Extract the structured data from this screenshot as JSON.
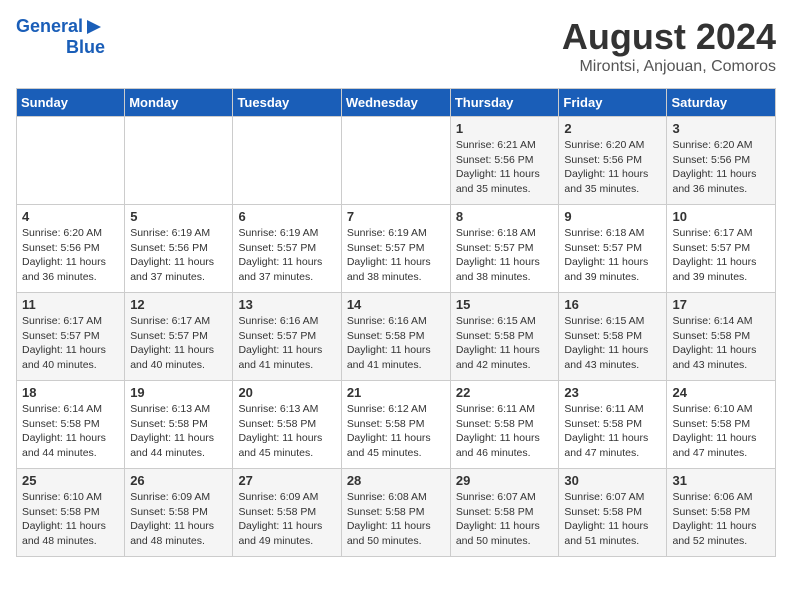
{
  "header": {
    "logo_line1": "General",
    "logo_line2": "Blue",
    "title": "August 2024",
    "subtitle": "Mirontsi, Anjouan, Comoros"
  },
  "days_of_week": [
    "Sunday",
    "Monday",
    "Tuesday",
    "Wednesday",
    "Thursday",
    "Friday",
    "Saturday"
  ],
  "weeks": [
    [
      {
        "day": "",
        "info": ""
      },
      {
        "day": "",
        "info": ""
      },
      {
        "day": "",
        "info": ""
      },
      {
        "day": "",
        "info": ""
      },
      {
        "day": "1",
        "info": "Sunrise: 6:21 AM\nSunset: 5:56 PM\nDaylight: 11 hours\nand 35 minutes."
      },
      {
        "day": "2",
        "info": "Sunrise: 6:20 AM\nSunset: 5:56 PM\nDaylight: 11 hours\nand 35 minutes."
      },
      {
        "day": "3",
        "info": "Sunrise: 6:20 AM\nSunset: 5:56 PM\nDaylight: 11 hours\nand 36 minutes."
      }
    ],
    [
      {
        "day": "4",
        "info": "Sunrise: 6:20 AM\nSunset: 5:56 PM\nDaylight: 11 hours\nand 36 minutes."
      },
      {
        "day": "5",
        "info": "Sunrise: 6:19 AM\nSunset: 5:56 PM\nDaylight: 11 hours\nand 37 minutes."
      },
      {
        "day": "6",
        "info": "Sunrise: 6:19 AM\nSunset: 5:57 PM\nDaylight: 11 hours\nand 37 minutes."
      },
      {
        "day": "7",
        "info": "Sunrise: 6:19 AM\nSunset: 5:57 PM\nDaylight: 11 hours\nand 38 minutes."
      },
      {
        "day": "8",
        "info": "Sunrise: 6:18 AM\nSunset: 5:57 PM\nDaylight: 11 hours\nand 38 minutes."
      },
      {
        "day": "9",
        "info": "Sunrise: 6:18 AM\nSunset: 5:57 PM\nDaylight: 11 hours\nand 39 minutes."
      },
      {
        "day": "10",
        "info": "Sunrise: 6:17 AM\nSunset: 5:57 PM\nDaylight: 11 hours\nand 39 minutes."
      }
    ],
    [
      {
        "day": "11",
        "info": "Sunrise: 6:17 AM\nSunset: 5:57 PM\nDaylight: 11 hours\nand 40 minutes."
      },
      {
        "day": "12",
        "info": "Sunrise: 6:17 AM\nSunset: 5:57 PM\nDaylight: 11 hours\nand 40 minutes."
      },
      {
        "day": "13",
        "info": "Sunrise: 6:16 AM\nSunset: 5:57 PM\nDaylight: 11 hours\nand 41 minutes."
      },
      {
        "day": "14",
        "info": "Sunrise: 6:16 AM\nSunset: 5:58 PM\nDaylight: 11 hours\nand 41 minutes."
      },
      {
        "day": "15",
        "info": "Sunrise: 6:15 AM\nSunset: 5:58 PM\nDaylight: 11 hours\nand 42 minutes."
      },
      {
        "day": "16",
        "info": "Sunrise: 6:15 AM\nSunset: 5:58 PM\nDaylight: 11 hours\nand 43 minutes."
      },
      {
        "day": "17",
        "info": "Sunrise: 6:14 AM\nSunset: 5:58 PM\nDaylight: 11 hours\nand 43 minutes."
      }
    ],
    [
      {
        "day": "18",
        "info": "Sunrise: 6:14 AM\nSunset: 5:58 PM\nDaylight: 11 hours\nand 44 minutes."
      },
      {
        "day": "19",
        "info": "Sunrise: 6:13 AM\nSunset: 5:58 PM\nDaylight: 11 hours\nand 44 minutes."
      },
      {
        "day": "20",
        "info": "Sunrise: 6:13 AM\nSunset: 5:58 PM\nDaylight: 11 hours\nand 45 minutes."
      },
      {
        "day": "21",
        "info": "Sunrise: 6:12 AM\nSunset: 5:58 PM\nDaylight: 11 hours\nand 45 minutes."
      },
      {
        "day": "22",
        "info": "Sunrise: 6:11 AM\nSunset: 5:58 PM\nDaylight: 11 hours\nand 46 minutes."
      },
      {
        "day": "23",
        "info": "Sunrise: 6:11 AM\nSunset: 5:58 PM\nDaylight: 11 hours\nand 47 minutes."
      },
      {
        "day": "24",
        "info": "Sunrise: 6:10 AM\nSunset: 5:58 PM\nDaylight: 11 hours\nand 47 minutes."
      }
    ],
    [
      {
        "day": "25",
        "info": "Sunrise: 6:10 AM\nSunset: 5:58 PM\nDaylight: 11 hours\nand 48 minutes."
      },
      {
        "day": "26",
        "info": "Sunrise: 6:09 AM\nSunset: 5:58 PM\nDaylight: 11 hours\nand 48 minutes."
      },
      {
        "day": "27",
        "info": "Sunrise: 6:09 AM\nSunset: 5:58 PM\nDaylight: 11 hours\nand 49 minutes."
      },
      {
        "day": "28",
        "info": "Sunrise: 6:08 AM\nSunset: 5:58 PM\nDaylight: 11 hours\nand 50 minutes."
      },
      {
        "day": "29",
        "info": "Sunrise: 6:07 AM\nSunset: 5:58 PM\nDaylight: 11 hours\nand 50 minutes."
      },
      {
        "day": "30",
        "info": "Sunrise: 6:07 AM\nSunset: 5:58 PM\nDaylight: 11 hours\nand 51 minutes."
      },
      {
        "day": "31",
        "info": "Sunrise: 6:06 AM\nSunset: 5:58 PM\nDaylight: 11 hours\nand 52 minutes."
      }
    ]
  ]
}
